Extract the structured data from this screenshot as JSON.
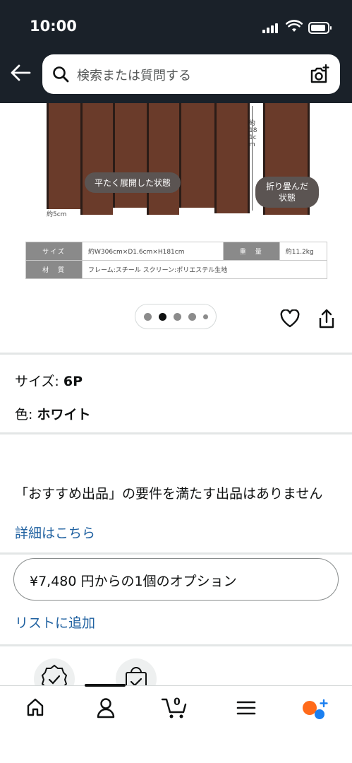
{
  "status_bar": {
    "time": "10:00"
  },
  "header": {
    "search_placeholder": "検索または質問する"
  },
  "product_image": {
    "tag_left": "平たく展開した状態",
    "tag_right_1": "折り畳んだ",
    "tag_right_2": "状態",
    "dim_height": "約181cm",
    "dim_foot": "約5cm",
    "spec": {
      "size_label": "サイズ",
      "size_value": "約W306cm×D1.6cm×H181cm",
      "weight_label": "重　量",
      "weight_value": "約11.2kg",
      "material_label": "材　質",
      "material_value": "フレーム:スチール スクリーン:ポリエステル生地"
    }
  },
  "carousel": {
    "total": 5,
    "active_index": 1
  },
  "variant": {
    "size_label": "サイズ:",
    "size_value": "6P",
    "color_label": "色:",
    "color_value": "ホワイト"
  },
  "offer": {
    "notice": "「おすすめ出品」の要件を満たす出品はありません",
    "details_link": "詳細はこちら",
    "option_button": "¥7,480 円からの1個のオプション",
    "wishlist_link": "リストに追加"
  },
  "cart": {
    "count": "0"
  },
  "colors": {
    "header_bg": "#1a2129",
    "link": "#2162a1",
    "panel": "#6a3b2a"
  }
}
